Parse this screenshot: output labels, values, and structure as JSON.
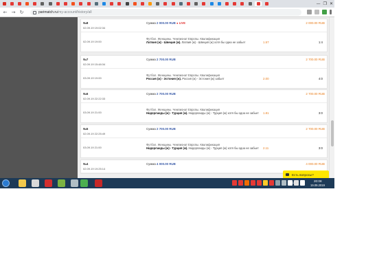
{
  "browser": {
    "tab_colors": [
      "#d93025",
      "#e53935",
      "#e53935",
      "#f4511e",
      "#e53935",
      "#616161",
      "#616161",
      "#e53935",
      "#e53935",
      "#f4511e",
      "#e53935",
      "#e53935",
      "#546e7a",
      "#1e88e5",
      "#e53935",
      "#e53935",
      "#424242",
      "#f4511e",
      "#e53935",
      "#ff9800",
      "#616161",
      "#e53935",
      "#e53935",
      "#546e7a",
      "#e53935",
      "#616161",
      "#e53935",
      "#1e88e5",
      "#1e88e5",
      "#e53935",
      "#e53935",
      "#e53935",
      "#616161",
      "#e53935",
      "#e53935"
    ],
    "window_controls": [
      "—",
      "❐",
      "✕"
    ],
    "nav": {
      "back": "←",
      "forward": "→",
      "reload": "↻"
    },
    "url_host": "parimatch.ru",
    "url_path": "/my-account/history/all"
  },
  "bets": [
    {
      "num": "№8",
      "placed": "02.09.19 19:02:34",
      "sum_label": "Сумма",
      "sum_amount": "2 000.00 RUB",
      "live": "● LIVE",
      "win": "2 000.00 RUB",
      "event_date": "02.09.19 19:00",
      "league": "Футбол. Женщины. Чемпионат Европы. Квалификация",
      "match": "Латвия (ж) - Швеция (ж).",
      "pick": "Латвия (ж) - Швеция (ж) хотя бы одна не забьет",
      "odds": "1.57",
      "score": "1:4"
    },
    {
      "num": "№7",
      "placed": "02.09.19 15:48:34",
      "sum_label": "Сумма",
      "sum_amount": "2 700.00 RUB",
      "live": "",
      "win": "2 700.00 RUB",
      "event_date": "03.09.19 19:00",
      "league": "Футбол. Женщины. Чемпионат Европы. Квалификация",
      "match": "Россия (ж) - Эстония (ж).",
      "pick": "Россия (ж) - Эстония (ж) забьет",
      "odds": "2.00",
      "score": "4:0"
    },
    {
      "num": "№6",
      "placed": "02.09.19 22:22:33",
      "sum_label": "Сумма",
      "sum_amount": "2 700.00 RUB",
      "live": "",
      "win": "2 700.00 RUB",
      "event_date": "03.09.19 21:00",
      "league": "Футбол. Женщины. Чемпионат Европы. Квалификация",
      "match": "Нидерланды (ж) - Турция (ж).",
      "pick": "Нидерланды (ж) - Турция (ж) хотя бы одна не забьет",
      "odds": "1.81",
      "score": "3:0"
    },
    {
      "num": "№5",
      "placed": "02.09.19 22:25:49",
      "sum_label": "Сумма",
      "sum_amount": "2 700.00 RUB",
      "live": "",
      "win": "2 700.00 RUB",
      "event_date": "03.09.19 21:00",
      "league": "Футбол. Женщины. Чемпионат Европы. Квалификация",
      "match": "Нидерланды (ж) - Турция (ж).",
      "pick": "Нидерланды (ж) - Турция (ж) хотя бы одна не забьет",
      "odds": "2.11",
      "score": "3:0"
    },
    {
      "num": "№4",
      "placed": "02.09.19 19:25:14",
      "sum_label": "Сумма",
      "sum_amount": "4 000.00 RUB",
      "live": "",
      "win": "4 000.00 RUB"
    }
  ],
  "help_widget": {
    "label": "Есть вопросы?"
  },
  "taskbar": {
    "apps": [
      {
        "name": "explorer",
        "color": "#f2c94c"
      },
      {
        "name": "media",
        "color": "#d9d9d9"
      },
      {
        "name": "opera",
        "color": "#d32f2f"
      },
      {
        "name": "paint",
        "color": "#7cb342"
      },
      {
        "name": "viewer",
        "color": "#b0bec5"
      },
      {
        "name": "chrome",
        "color": "#4caf50"
      },
      {
        "name": "app-red",
        "color": "#c62828"
      }
    ],
    "tray_colors": [
      "#e53935",
      "#e53935",
      "#ef6c00",
      "#e53935",
      "#e53935",
      "#ffca28",
      "#e53935",
      "#90a4ae",
      "#b0bec5",
      "#ffffff",
      "#e0e0e0",
      "#ffffff"
    ],
    "lang": "RU",
    "time": "20:08",
    "date": "19.09.2019"
  }
}
